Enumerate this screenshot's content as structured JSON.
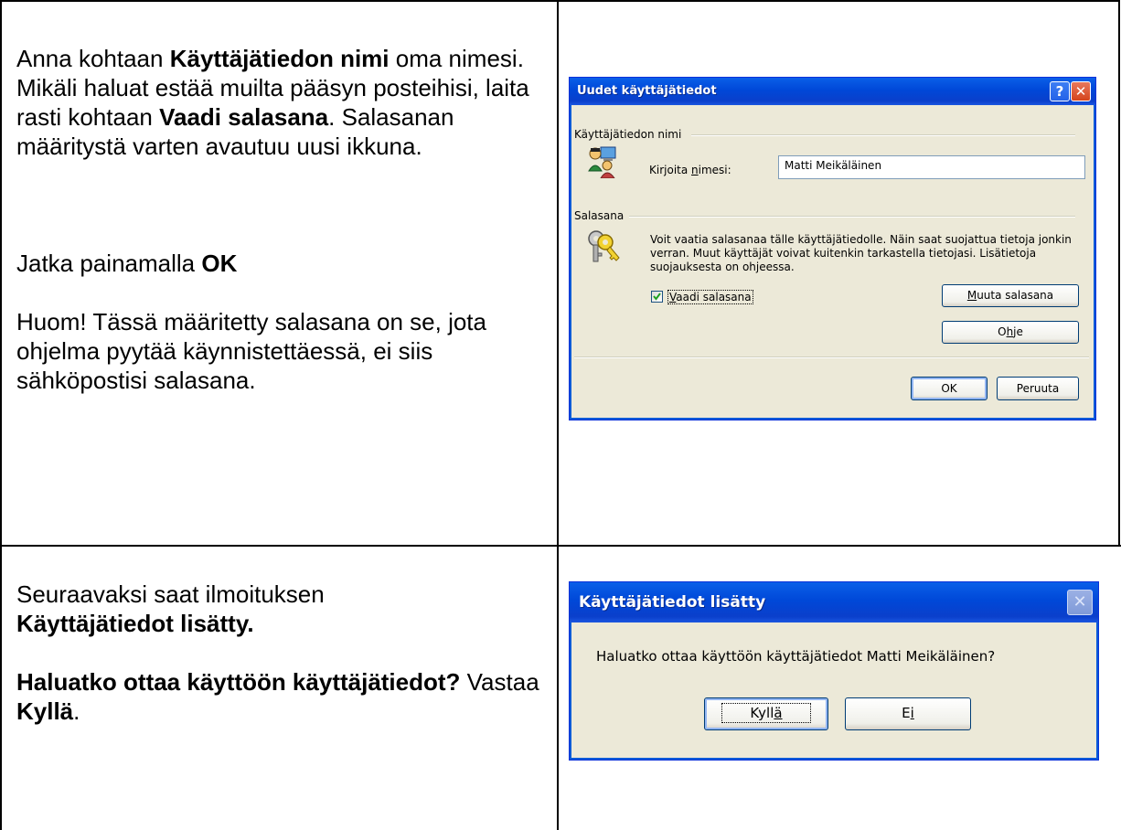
{
  "row1": {
    "para1": {
      "t1": "Anna kohtaan ",
      "b1": "Käyttäjätiedon nimi",
      "t2": " oma nimesi. Mikäli haluat estää muilta pääsyn posteihisi, laita rasti kohtaan ",
      "b2": "Vaadi salasana",
      "t3": ". Salasanan määritystä varten avautuu uusi ikkuna."
    },
    "para2": {
      "t1": "Jatka painamalla ",
      "b1": "OK"
    },
    "para3": {
      "t1": "Huom! Tässä määritetty salasana on se, jota ohjelma pyytää käynnistettäessä, ei siis sähköpostisi salasana."
    }
  },
  "dialog1": {
    "title": "Uudet käyttäjätiedot",
    "help_icon": "help-icon",
    "close_icon": "close-icon",
    "section_name": "Käyttäjätiedon nimi",
    "name_label_pre": "Kirjoita ",
    "name_label_u": "n",
    "name_label_post": "imesi:",
    "name_value": "Matti Meikäläinen",
    "section_password": "Salasana",
    "password_text": "Voit vaatia salasanaa tälle käyttäjätiedolle. Näin saat suojattua tietoja jonkin verran. Muut käyttäjät voivat kuitenkin tarkastella tietojasi. Lisätietoja suojauksesta on ohjeessa.",
    "require_pw_u": "V",
    "require_pw_rest": "aadi salasana",
    "require_pw_checked": true,
    "change_pw_u": "M",
    "change_pw_rest": "uuta salasana",
    "help_btn_pre": "O",
    "help_btn_u": "h",
    "help_btn_post": "je",
    "ok": "OK",
    "cancel": "Peruuta"
  },
  "row2": {
    "para1": {
      "t1": "Seuraavaksi saat ilmoituksen",
      "b1": "Käyttäjätiedot lisätty."
    },
    "para2": {
      "b1": "Haluatko ottaa käyttöön käyttäjätiedot?",
      "t1": " Vastaa ",
      "b2": "Kyllä",
      "t2": "."
    }
  },
  "dialog2": {
    "title": "Käyttäjätiedot lisätty",
    "message": "Haluatko ottaa käyttöön käyttäjätiedot Matti Meikäläinen?",
    "yes_pre": "Kyll",
    "yes_u": "ä",
    "no_pre": "E",
    "no_u": "i"
  }
}
